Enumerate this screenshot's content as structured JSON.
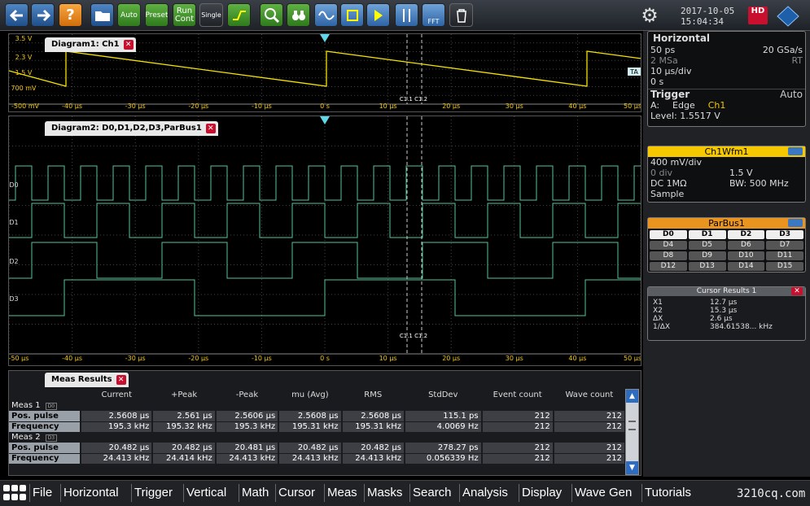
{
  "toolbar": {
    "auto": "Auto",
    "preset": "Preset",
    "run_cont": "Run Cont",
    "single": "Single",
    "fft": "FFT",
    "help": "?"
  },
  "datetime": {
    "date": "2017-10-05",
    "time": "15:04:34"
  },
  "hd_badge": "HD",
  "diagram1": {
    "title": "Diagram1: Ch1",
    "ylabels": [
      "3.5 V",
      "2.3 V",
      "1.5 V",
      "700 mV",
      "-500 mV"
    ],
    "xlabels": [
      "-50 µs",
      "-40 µs",
      "-30 µs",
      "-20 µs",
      "-10 µs",
      "0 s",
      "10 µs",
      "20 µs",
      "30 µs",
      "40 µs",
      "50 µs"
    ],
    "cursors": "C1.1 C1.2",
    "trig_marker": "TA",
    "ch_marker": "1"
  },
  "diagram2": {
    "title": "Diagram2: D0,D1,D2,D3,ParBus1",
    "channels": [
      "D0",
      "D1",
      "D2",
      "D3"
    ],
    "xlabels": [
      "-50 µs",
      "-40 µs",
      "-30 µs",
      "-20 µs",
      "-10 µs",
      "0 s",
      "10 µs",
      "20 µs",
      "30 µs",
      "40 µs",
      "50 µs"
    ],
    "cursors": "C1.1 C1.2"
  },
  "horizontal": {
    "title": "Horizontal",
    "r1l": "50 ps",
    "r1r": "20 GSa/s",
    "r2l": "2 MSa",
    "r2r": "RT",
    "r3": "10 µs/div",
    "r4": "0 s"
  },
  "trigger": {
    "title": "Trigger",
    "mode": "Auto",
    "type_label": "A:",
    "type": "Edge",
    "source": "Ch1",
    "level": "Level: 1.5517 V"
  },
  "ch1": {
    "title": "Ch1Wfm1",
    "scale": "400 mV/div",
    "pos_l": "0 div",
    "pos_r": "1.5 V",
    "coupling": "DC 1MΩ",
    "bw": "BW: 500 MHz",
    "acq": "Sample"
  },
  "parbus": {
    "title": "ParBus1",
    "bits": [
      "D0",
      "D1",
      "D2",
      "D3",
      "D4",
      "D5",
      "D6",
      "D7",
      "D8",
      "D9",
      "D10",
      "D11",
      "D12",
      "D13",
      "D14",
      "D15"
    ]
  },
  "cursor_results": {
    "title": "Cursor Results 1",
    "rows": [
      [
        "X1",
        "12.7 µs"
      ],
      [
        "X2",
        "15.3 µs"
      ],
      [
        "ΔX",
        "2.6 µs"
      ],
      [
        "1/ΔX",
        "384.61538... kHz"
      ]
    ]
  },
  "meas": {
    "title": "Meas Results",
    "headers": [
      "",
      "Current",
      "+Peak",
      "-Peak",
      "mu (Avg)",
      "RMS",
      "StdDev",
      "Event count",
      "Wave count"
    ],
    "groups": [
      {
        "name": "Meas 1",
        "src": "D0",
        "rows": [
          [
            "Pos. pulse",
            "2.5608 µs",
            "2.561 µs",
            "2.5606 µs",
            "2.5608 µs",
            "2.5608 µs",
            "115.1 ps",
            "212",
            "212"
          ],
          [
            "Frequency",
            "195.3 kHz",
            "195.32 kHz",
            "195.3 kHz",
            "195.31 kHz",
            "195.31 kHz",
            "4.0069 Hz",
            "212",
            "212"
          ]
        ]
      },
      {
        "name": "Meas 2",
        "src": "D3",
        "rows": [
          [
            "Pos. pulse",
            "20.482 µs",
            "20.482 µs",
            "20.481 µs",
            "20.482 µs",
            "20.482 µs",
            "278.27 ps",
            "212",
            "212"
          ],
          [
            "Frequency",
            "24.413 kHz",
            "24.414 kHz",
            "24.413 kHz",
            "24.413 kHz",
            "24.413 kHz",
            "0.056339 Hz",
            "212",
            "212"
          ]
        ]
      }
    ]
  },
  "menu": [
    "File",
    "Horizontal",
    "Trigger",
    "Vertical",
    "Math",
    "Cursor",
    "Meas",
    "Masks",
    "Search",
    "Analysis",
    "Display",
    "Wave Gen",
    "Tutorials"
  ],
  "site": "3210cq.com"
}
